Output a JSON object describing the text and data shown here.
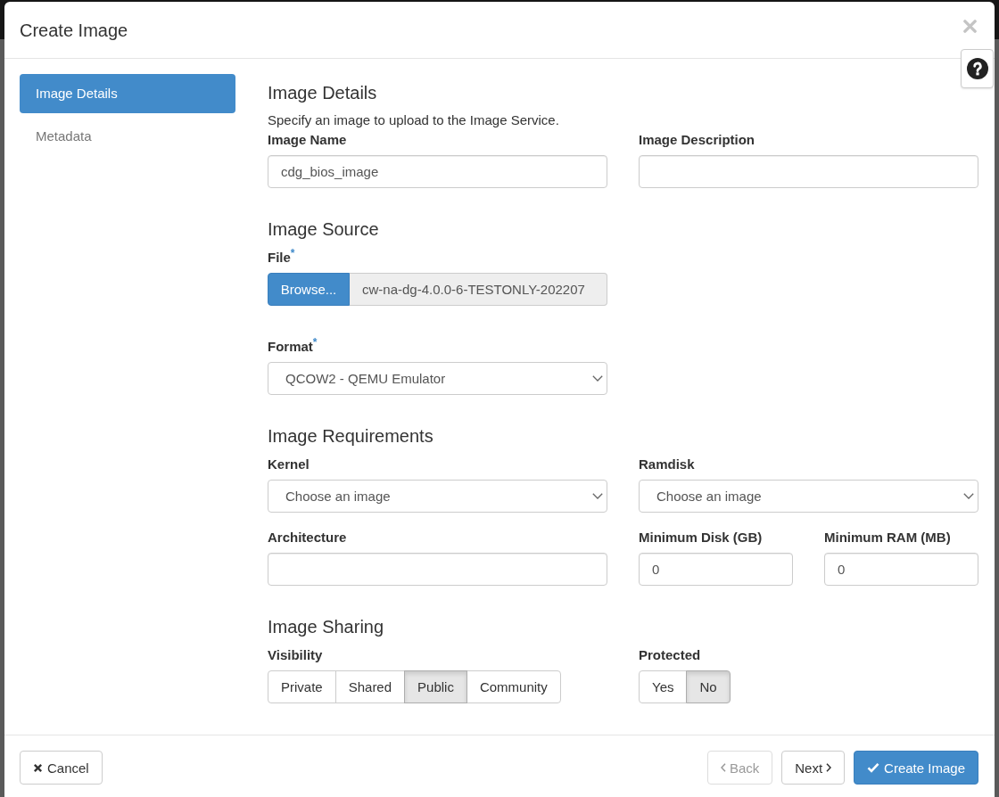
{
  "dialog": {
    "title": "Create Image"
  },
  "steps": [
    {
      "label": "Image Details",
      "selected": true
    },
    {
      "label": "Metadata",
      "selected": false
    }
  ],
  "sections": [
    {
      "title": "Image Details",
      "description": "Specify an image to upload to the Image Service.",
      "rows": [
        [
          {
            "kind": "text",
            "label": "Image Name",
            "value": "cdg_bios_image"
          },
          {
            "kind": "text",
            "label": "Image Description"
          }
        ]
      ]
    },
    {
      "title": "Image Source",
      "rows": [
        [
          {
            "kind": "file",
            "label": "File$^{*}$",
            "button": "Browse...",
            "value": "cw-na-dg-4.0.0-6-TESTONLY-202207"
          }
        ],
        [
          {
            "kind": "select",
            "label": "Format$^{*}$",
            "value": "QCOW2 - QEMU Emulator"
          }
        ]
      ]
    },
    {
      "title": "Image Requirements",
      "rows": [
        [
          {
            "kind": "select",
            "label": "Kernel",
            "value": "Choose an image"
          },
          {
            "kind": "select",
            "label": "Ramdisk",
            "value": "Choose an image"
          }
        ],
        [
          {
            "kind": "text",
            "label": "Architecture"
          },
          {
            "kind": "number",
            "label": "Minimum Disk (GB)",
            "value": "0"
          },
          {
            "kind": "number",
            "label": "Minimum RAM (MB)",
            "value": "0"
          }
        ]
      ]
    },
    {
      "title": "Image Sharing",
      "rows": [
        [
          {
            "kind": "toggle",
            "label": "Visibility",
            "options": [
              {
                "label": "Private",
                "selected": false
              },
              {
                "label": "Shared",
                "selected": false
              },
              {
                "label": "Public",
                "selected": true
              },
              {
                "label": "Community",
                "selected": false
              }
            ]
          },
          {
            "kind": "toggle",
            "label": "Protected",
            "options": [
              {
                "label": "Yes",
                "selected": false
              },
              {
                "label": "No",
                "selected": true
              }
            ]
          }
        ]
      ]
    }
  ],
  "footer_buttons": [
    {
      "kind": "cancel",
      "label": "Cancel",
      "disabled": false
    },
    {
      "kind": "back",
      "label": "Back",
      "disabled": true
    },
    {
      "kind": "next",
      "label": "Next",
      "disabled": false
    },
    {
      "kind": "primary",
      "label": "Create Image",
      "disabled": false
    }
  ]
}
